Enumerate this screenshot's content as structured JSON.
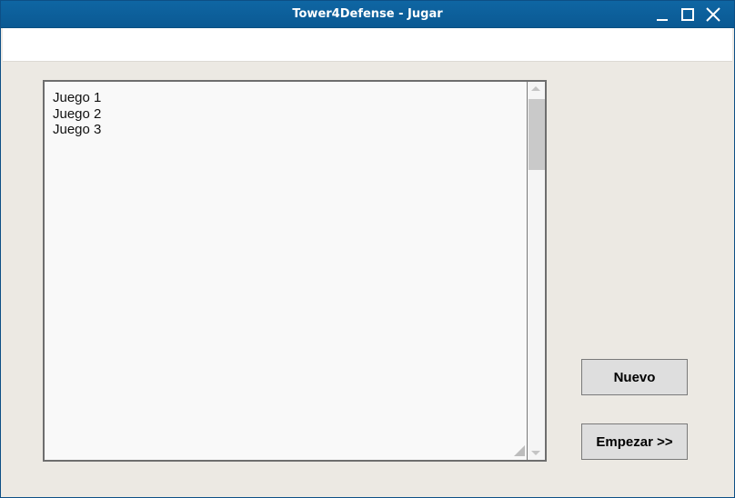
{
  "window": {
    "title": "Tower4Defense - Jugar",
    "controls": [
      "minimize-icon",
      "maximize-icon",
      "close-icon"
    ]
  },
  "games_list": {
    "items": [
      "Juego 1",
      "Juego 2",
      "Juego 3"
    ]
  },
  "buttons": {
    "new_label": "Nuevo",
    "start_label": "Empezar >>"
  },
  "colors": {
    "titlebar": "#0c5f9c",
    "window_bg": "#ece9e3",
    "list_bg": "#f9f9f9",
    "button_bg": "#dedede"
  }
}
